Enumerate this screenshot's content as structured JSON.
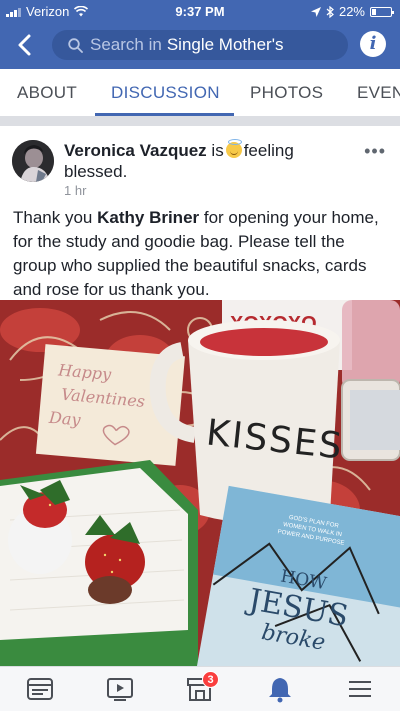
{
  "status_bar": {
    "carrier": "Verizon",
    "time": "9:37 PM",
    "battery": "22%",
    "battery_level": 0.22
  },
  "header": {
    "search_placeholder": "Search in",
    "search_group": "Single Mother's"
  },
  "tabs": [
    {
      "label": "ABOUT"
    },
    {
      "label": "DISCUSSION"
    },
    {
      "label": "PHOTOS"
    },
    {
      "label": "EVEN"
    }
  ],
  "active_tab": "DISCUSSION",
  "post": {
    "author": "Veronica Vazquez",
    "activity_prefix": "is",
    "activity": "feeling blessed.",
    "time": "1 hr",
    "message_part1": "Thank you ",
    "mentioned_user": "Kathy Briner",
    "message_part2": " for opening your home, for the study and goodie bag.  Please tell the group who supplied the beautiful snacks,  cards and rose for us thank you.",
    "photo": {
      "card_text_1": "Happy",
      "card_text_2": "Valentines",
      "card_text_3": "Day",
      "mug_text": "KISSES",
      "bag_text": "XOXOXO",
      "book_subtitle_1": "GOD'S PLAN FOR",
      "book_subtitle_2": "WOMEN TO WALK IN",
      "book_subtitle_3": "POWER AND PURPOSE",
      "book_title_1": "HOW",
      "book_title_2": "JESUS",
      "book_title_3": "broke"
    }
  },
  "bottom_nav": {
    "marketplace_badge": "3"
  },
  "colors": {
    "brand": "#4267b2",
    "badge": "#fa3e3e"
  }
}
